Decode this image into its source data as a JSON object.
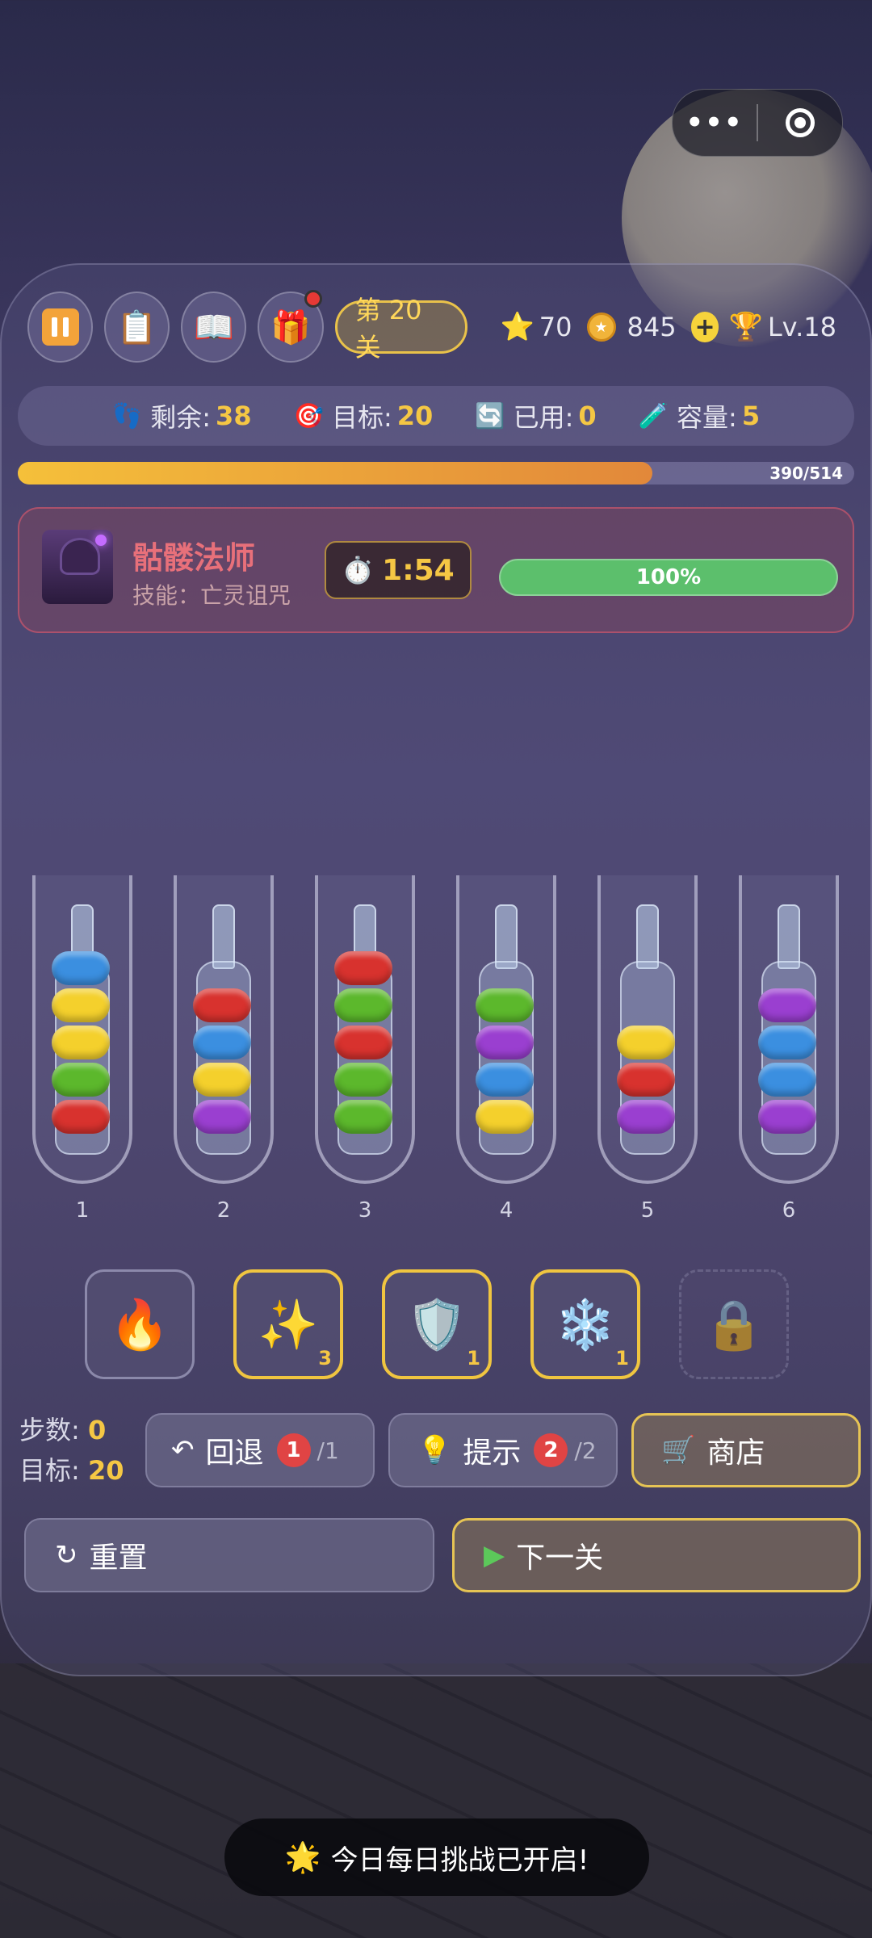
{
  "capsule": {
    "more_label": "•••"
  },
  "header": {
    "level_label": "第 20 关",
    "stars": "70",
    "coins": "845",
    "plus_label": "+",
    "level_rank": "Lv.18"
  },
  "info": {
    "remaining_label": "剩余:",
    "remaining_value": "38",
    "target_label": "目标:",
    "target_value": "20",
    "used_label": "已用:",
    "used_value": "0",
    "capacity_label": "容量:",
    "capacity_value": "5"
  },
  "progress": {
    "value": 390,
    "max": 514,
    "label": "390/514"
  },
  "boss": {
    "name": "骷髅法师",
    "skill": "技能：亡灵诅咒",
    "timer": "1:54",
    "hp_label": "100%",
    "hp_fraction": 1.0
  },
  "colors": {
    "red": "#d8322e",
    "yellow": "#f4d02c",
    "green": "#5cb82c",
    "blue": "#3b8fe0",
    "purple": "#9a3fd0"
  },
  "tubes": [
    {
      "label": "1",
      "balls": [
        "red",
        "green",
        "yellow",
        "yellow",
        "blue"
      ]
    },
    {
      "label": "2",
      "balls": [
        "purple",
        "yellow",
        "blue",
        "red"
      ]
    },
    {
      "label": "3",
      "balls": [
        "green",
        "green",
        "red",
        "green",
        "red"
      ]
    },
    {
      "label": "4",
      "balls": [
        "yellow",
        "blue",
        "purple",
        "green"
      ]
    },
    {
      "label": "5",
      "balls": [
        "purple",
        "red",
        "yellow"
      ]
    },
    {
      "label": "6",
      "balls": [
        "purple",
        "blue",
        "blue",
        "purple"
      ]
    }
  ],
  "powerups": [
    {
      "icon": "🔥",
      "count": ""
    },
    {
      "icon": "✨",
      "count": "3"
    },
    {
      "icon": "🛡️",
      "count": "1"
    },
    {
      "icon": "❄️",
      "count": "1"
    },
    {
      "icon": "🔒",
      "count": ""
    }
  ],
  "stats": {
    "steps_label": "步数:",
    "steps_value": "0",
    "target_label": "目标:",
    "target_value": "20"
  },
  "actions": {
    "undo_label": "回退",
    "undo_count": "1",
    "undo_max": "/1",
    "hint_label": "提示",
    "hint_count": "2",
    "hint_max": "/2",
    "shop_label": "商店",
    "reset_label": "重置",
    "next_label": "下一关"
  },
  "toast": {
    "text": "今日每日挑战已开启!"
  }
}
